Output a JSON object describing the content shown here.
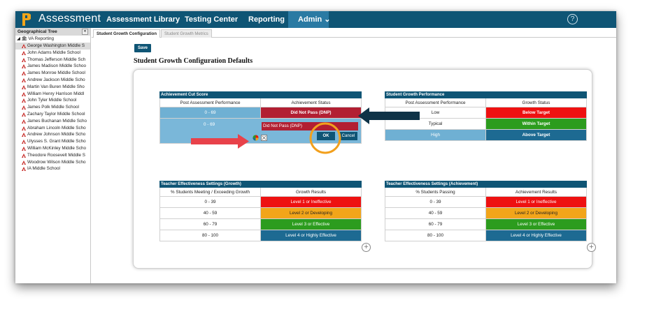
{
  "app": {
    "title": "Assessment"
  },
  "nav": [
    {
      "label": "Assessment Library"
    },
    {
      "label": "Testing Center"
    },
    {
      "label": "Reporting ⌄"
    },
    {
      "label": "Admin ⌄"
    }
  ],
  "help": {
    "label": "?"
  },
  "sidebar": {
    "title": "Geographical Tree",
    "collapse": "«",
    "root": "◢ 🏛 VA Reporting",
    "items": [
      {
        "label": "George Washington Middle S"
      },
      {
        "label": "John Adams Middle School"
      },
      {
        "label": "Thomas Jefferson Middle Sch"
      },
      {
        "label": "James Madison Middle Schoo"
      },
      {
        "label": "James Monroe Middle School"
      },
      {
        "label": "Andrew Jackson Middle Scho"
      },
      {
        "label": "Martin Van Buren Middle Sho"
      },
      {
        "label": "William Henry Harrison Middl"
      },
      {
        "label": "John Tyler Middle School"
      },
      {
        "label": "James Polk Middle School"
      },
      {
        "label": "Zachary Taylor Middle School"
      },
      {
        "label": "James Buchanan Middle Scho"
      },
      {
        "label": "Abraham Lincoln Middle Scho"
      },
      {
        "label": "Andrew Johnson Middle Scho"
      },
      {
        "label": "Ulysses S. Grant Middle Scho"
      },
      {
        "label": "William McKinley Middle Scho"
      },
      {
        "label": "Theodore Roosevelt Middle S"
      },
      {
        "label": "Woodrow Wilson Middle Scho"
      },
      {
        "label": "IA Middle School"
      }
    ]
  },
  "tabs": [
    {
      "label": "Student Growth Configuration"
    },
    {
      "label": "Student Growth Metrics"
    }
  ],
  "save_label": "Save",
  "page_title": "Student Growth Configuration Defaults",
  "achievement_cut": {
    "title": "Achievement Cut Score",
    "headers": [
      "Post Assessment Performance",
      "Achievement Status"
    ],
    "row1": {
      "range": "0 - 69",
      "status": "Did Not Pass (DNP)"
    },
    "edit": {
      "range": "0 - 69",
      "status": "Did Not Pass (DNP)",
      "ok": "OK",
      "cancel": "Cancel"
    }
  },
  "growth_perf": {
    "title": "Student Growth Performance",
    "headers": [
      "Post Assessment Performance",
      "Growth Status"
    ],
    "rows": [
      {
        "perf": "Low",
        "status": "Below Target"
      },
      {
        "perf": "Typical",
        "status": "Within Target"
      },
      {
        "perf": "High",
        "status": "Above Target"
      }
    ]
  },
  "te_growth": {
    "title": "Teacher Effectiveness Settings (Growth)",
    "headers": [
      "% Students Meeting / Exceeding Growth",
      "Growth Results"
    ],
    "rows": [
      {
        "range": "0 - 39",
        "result": "Level 1 or Ineffective"
      },
      {
        "range": "40 - 59",
        "result": "Level 2 or Developing"
      },
      {
        "range": "60 - 79",
        "result": "Level 3 or Effective"
      },
      {
        "range": "80 - 100",
        "result": "Level 4 or Highly Effective"
      }
    ]
  },
  "te_achievement": {
    "title": "Teacher Effectiveness Settings (Achievement)",
    "headers": [
      "% Students Passing",
      "Achievement Results"
    ],
    "rows": [
      {
        "range": "0 - 39",
        "result": "Level 1 or Ineffective"
      },
      {
        "range": "40 - 59",
        "result": "Level 2 or Developing"
      },
      {
        "range": "60 - 79",
        "result": "Level 3 or Effective"
      },
      {
        "range": "80 - 100",
        "result": "Level 4 or Highly Effective"
      }
    ]
  },
  "add_label": "+",
  "colors": {
    "header": "#0f5575",
    "red": "#ee1111",
    "orange": "#f2a51a",
    "green": "#2c9c1e",
    "blue": "#1d6a92",
    "dnp": "#b21f32",
    "annotation_orange": "#f2a01d",
    "annotation_red": "#e8424a",
    "annotation_arrow": "#0f3347"
  }
}
